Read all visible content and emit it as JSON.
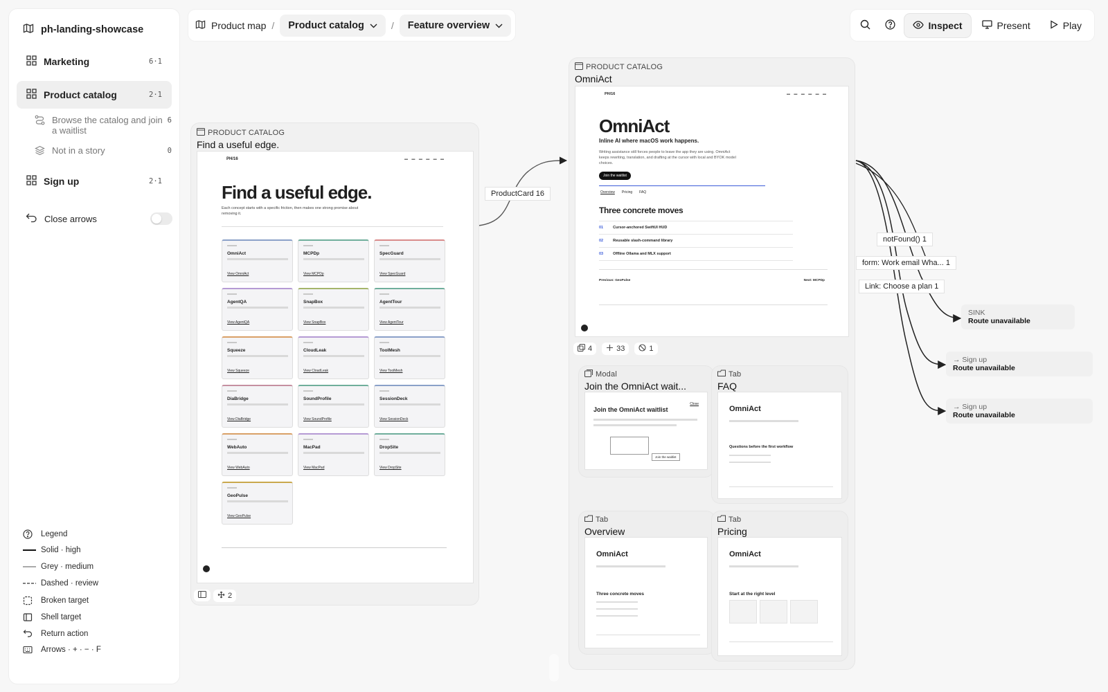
{
  "project": {
    "name": "ph-landing-showcase",
    "icon": "map-icon"
  },
  "sidebar": {
    "items": [
      {
        "label": "Marketing",
        "count": "6·1"
      },
      {
        "label": "Product catalog",
        "count": "2·1"
      },
      {
        "label": "Sign up",
        "count": "2·1"
      }
    ],
    "sub_items": [
      {
        "label": "Browse the catalog and join a waitlist",
        "count": "6"
      },
      {
        "label": "Not in a story",
        "count": "0"
      }
    ],
    "close_arrows": "Close arrows"
  },
  "legend": {
    "title": "Legend",
    "items": [
      "Solid · high",
      "Grey · medium",
      "Dashed · review",
      "Broken target",
      "Shell target",
      "Return action",
      "Arrows · + · − · F"
    ]
  },
  "breadcrumb": {
    "root": "Product map",
    "level1": "Product catalog",
    "level2": "Feature overview",
    "separator": "/"
  },
  "toolbar": {
    "inspect": "Inspect",
    "present": "Present",
    "play": "Play"
  },
  "canvas": {
    "catalog_card": {
      "type": "PRODUCT CATALOG",
      "title": "Find a useful edge.",
      "brand": "PH/16",
      "hero": "Find a useful edge.",
      "hero_sub": "Each concept starts with a specific friction, then makes one strong promise about removing it.",
      "products": [
        {
          "name": "OmniAct",
          "link": "View OmniAct",
          "color": "#8aa0c8"
        },
        {
          "name": "MCPDp",
          "link": "View MCPDp",
          "color": "#6fae9b"
        },
        {
          "name": "SpecGuard",
          "link": "View SpecGuard",
          "color": "#d98a8a"
        },
        {
          "name": "AgentQA",
          "link": "View AgentQA",
          "color": "#b59ad4"
        },
        {
          "name": "SnapBox",
          "link": "View SnapBox",
          "color": "#a5b56a"
        },
        {
          "name": "AgentTour",
          "link": "View AgentTour",
          "color": "#6fae9b"
        },
        {
          "name": "Squeeze",
          "link": "View Squeeze",
          "color": "#d9a066"
        },
        {
          "name": "CloudLeak",
          "link": "View CloudLeak",
          "color": "#b59ad4"
        },
        {
          "name": "ToolMesh",
          "link": "View ToolMesh",
          "color": "#8aa0c8"
        },
        {
          "name": "DiaBridge",
          "link": "View DiaBridge",
          "color": "#c58fa0"
        },
        {
          "name": "SoundProfile",
          "link": "View SoundProfile",
          "color": "#6fae9b"
        },
        {
          "name": "SessionDeck",
          "link": "View SessionDeck",
          "color": "#8aa0c8"
        },
        {
          "name": "WebAuto",
          "link": "View WebAuto",
          "color": "#d9a066"
        },
        {
          "name": "MacPad",
          "link": "View MacPad",
          "color": "#b59ad4"
        },
        {
          "name": "DropSite",
          "link": "View DropSite",
          "color": "#6fae9b"
        },
        {
          "name": "GeoPulse",
          "link": "View GeoPulse",
          "color": "#c9a84c"
        }
      ],
      "chip_count": "2"
    },
    "edge_label": "ProductCard 16",
    "omni_card": {
      "type": "PRODUCT CATALOG",
      "title": "OmniAct",
      "brand": "PH/16",
      "hero": "OmniAct",
      "tagline": "Inline AI where macOS work happens.",
      "desc": "Writing assistance still forces people to leave the app they are using. OmniAct keeps rewriting, translation, and drafting at the cursor with local and BYOK model choices.",
      "cta": "Join the waitlist",
      "tabs": [
        "Overview",
        "Pricing",
        "FAQ"
      ],
      "moves_title": "Three concrete moves",
      "moves": [
        {
          "n": "01",
          "t": "Cursor-anchored SwiftUI HUD"
        },
        {
          "n": "02",
          "t": "Reusable slash-command library"
        },
        {
          "n": "03",
          "t": "Offline Ollama and MLX support"
        }
      ],
      "prev": "Previous: GeoPulse",
      "next": "Next: MCPDp",
      "chips": [
        "4",
        "33",
        "1"
      ]
    },
    "modal_card": {
      "type": "Modal",
      "title": "Join the OmniAct wait...",
      "heading": "Join the OmniAct waitlist",
      "close": "Close",
      "submit": "Join the waitlist"
    },
    "faq_card": {
      "type": "Tab",
      "title": "FAQ",
      "hero": "OmniAct",
      "section": "Questions before the first workflow"
    },
    "overview_card": {
      "type": "Tab",
      "title": "Overview",
      "hero": "OmniAct",
      "section": "Three concrete moves"
    },
    "pricing_card": {
      "type": "Tab",
      "title": "Pricing",
      "hero": "OmniAct",
      "section": "Start at the right level"
    },
    "outgoing": [
      "notFound() 1",
      "form: Work email Wha... 1",
      "Link: Choose a plan 1"
    ],
    "sinks": [
      {
        "kind": "SINK",
        "label": "Route unavailable"
      },
      {
        "kind": "→ Sign up",
        "label": "Route unavailable"
      },
      {
        "kind": "→ Sign up",
        "label": "Route unavailable"
      }
    ]
  }
}
